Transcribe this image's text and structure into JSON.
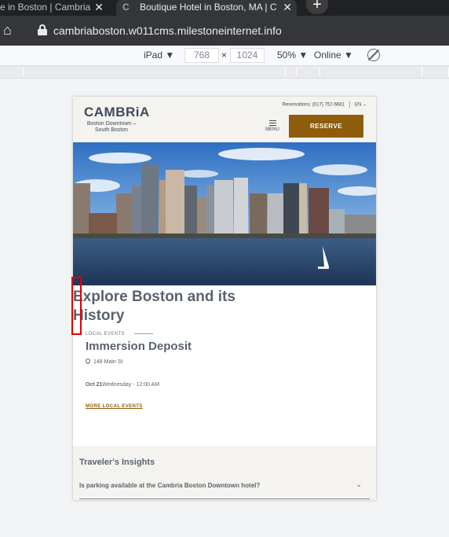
{
  "browser": {
    "tabs": [
      {
        "label": "e in Boston | Cambria",
        "active": false
      },
      {
        "label": "Boutique Hotel in Boston, MA | C",
        "active": true
      }
    ],
    "url": "cambriaboston.w011cms.milestoneinternet.info",
    "device": {
      "name": "iPad",
      "width": "768",
      "height": "1024",
      "zoom": "50%",
      "network": "Online"
    }
  },
  "site": {
    "brand": "CAMBRiA",
    "brand_sub": "Boston Downtown – South Boston",
    "reservations": "Reservations: (617) 752-6681",
    "language": "EN",
    "menu_label": "MENU",
    "reserve_label": "RESERVE",
    "section_title": "Explore Boston and its History",
    "event_label": "LOCAL EVENTS",
    "event_name": "Immersion Deposit",
    "event_address": "148 Main St",
    "event_date": "Oct 21",
    "event_time": "Wednesday - 12:00 AM",
    "more_events": "MORE LOCAL EVENTS",
    "insights_heading": "Traveler's Insights",
    "faq_question": "Is parking available at the Cambria Boston Downtown hotel?"
  },
  "colors": {
    "accent": "#8e5d0b",
    "header_bg": "#f5f3ef",
    "text": "#5a6270"
  }
}
